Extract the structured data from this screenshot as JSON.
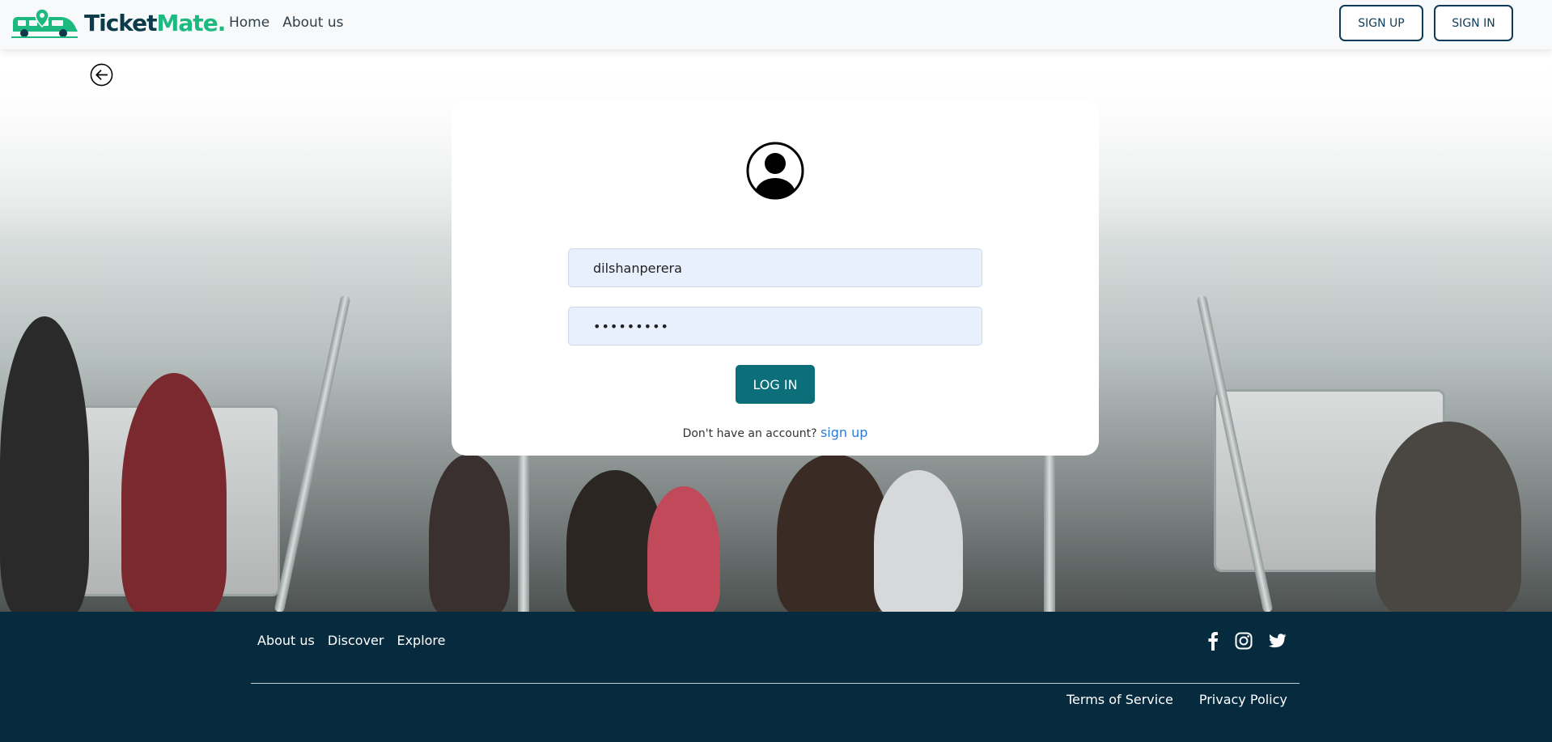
{
  "brand": {
    "name_part1": "Ticket",
    "name_part2": "Mate",
    "name_dot": "."
  },
  "nav": {
    "links": [
      "Home",
      "About us"
    ],
    "signup_label": "SIGN UP",
    "signin_label": "SIGN IN"
  },
  "login": {
    "username_value": "dilshanperera",
    "password_value": "•••••••••",
    "login_label": "LOG IN",
    "no_account_text": "Don't have an account?",
    "signup_link": "sign up"
  },
  "footer": {
    "links": [
      "About us",
      "Discover",
      "Explore"
    ],
    "social_icons": [
      "facebook-icon",
      "instagram-icon",
      "twitter-icon"
    ],
    "terms": "Terms of Service",
    "privacy": "Privacy Policy"
  },
  "colors": {
    "accent": "#0b6e79",
    "brand_dark": "#0c3b4a",
    "brand_green": "#1eb980",
    "footer_bg": "#072b3e",
    "link": "#2e7bd6"
  }
}
